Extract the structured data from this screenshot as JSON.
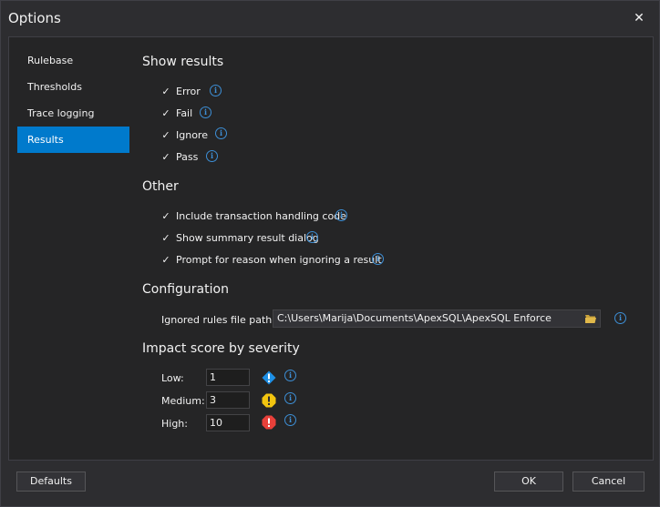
{
  "window": {
    "title": "Options"
  },
  "nav": {
    "items": [
      {
        "label": "Rulebase"
      },
      {
        "label": "Thresholds"
      },
      {
        "label": "Trace logging"
      },
      {
        "label": "Results",
        "selected": true
      }
    ]
  },
  "show_results": {
    "title": "Show results",
    "items": [
      {
        "label": "Error",
        "checked": true
      },
      {
        "label": "Fail",
        "checked": true
      },
      {
        "label": "Ignore",
        "checked": true
      },
      {
        "label": "Pass",
        "checked": true
      }
    ]
  },
  "other": {
    "title": "Other",
    "items": [
      {
        "label": "Include transaction handling code",
        "checked": true
      },
      {
        "label": "Show summary result dialog",
        "checked": true
      },
      {
        "label": "Prompt for reason when ignoring a result",
        "checked": true
      }
    ]
  },
  "configuration": {
    "title": "Configuration",
    "path_label": "Ignored rules file path :",
    "path_value": "C:\\Users\\Marija\\Documents\\ApexSQL\\ApexSQL Enforce"
  },
  "impact": {
    "title": "Impact score by severity",
    "rows": [
      {
        "label": "Low:",
        "value": "1",
        "color": "#1e90e6"
      },
      {
        "label": "Medium:",
        "value": "3",
        "color": "#f2c40f"
      },
      {
        "label": "High:",
        "value": "10",
        "color": "#e8403a"
      }
    ]
  },
  "buttons": {
    "defaults": "Defaults",
    "ok": "OK",
    "cancel": "Cancel"
  },
  "icons": {
    "info": "i",
    "check": "✓",
    "close": "✕",
    "exclaim": "!"
  },
  "colors": {
    "accent": "#007acc",
    "info": "#3d8fd6"
  }
}
